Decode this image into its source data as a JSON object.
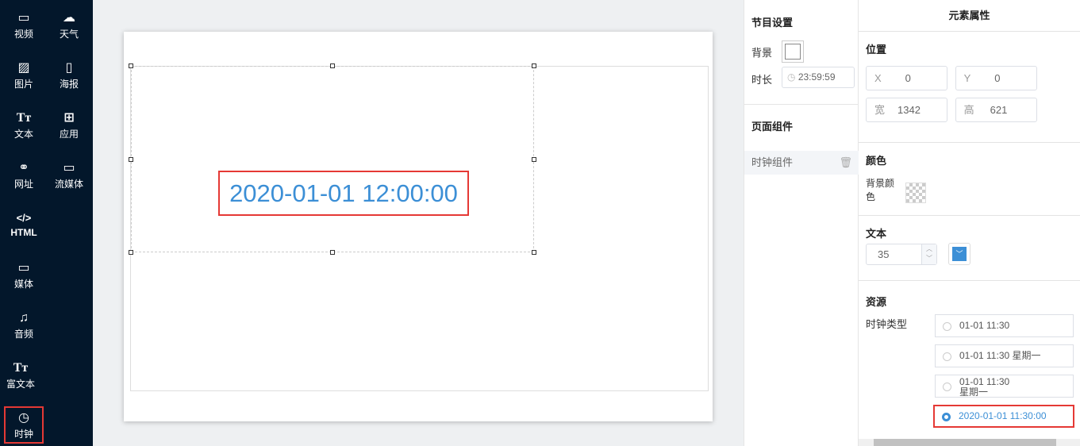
{
  "sidebar": {
    "tools": [
      {
        "label": "视频",
        "icon": "video-icon"
      },
      {
        "label": "天气",
        "icon": "cloud-icon"
      },
      {
        "label": "图片",
        "icon": "image-icon"
      },
      {
        "label": "海报",
        "icon": "poster-icon"
      },
      {
        "label": "文本",
        "icon": "text-icon"
      },
      {
        "label": "应用",
        "icon": "apps-icon"
      },
      {
        "label": "网址",
        "icon": "link-icon"
      },
      {
        "label": "流媒体",
        "icon": "stream-icon"
      },
      {
        "label": "HTML",
        "icon": "code-icon"
      },
      {
        "label": "媒体",
        "icon": "media-icon"
      },
      {
        "label": "音频",
        "icon": "music-icon"
      },
      {
        "label": "富文本",
        "icon": "richtext-icon"
      },
      {
        "label": "时钟",
        "icon": "clock-icon"
      }
    ]
  },
  "canvas": {
    "clock_text": "2020-01-01 12:00:00"
  },
  "program": {
    "title": "节目设置",
    "bg_label": "背景",
    "duration_label": "时长",
    "duration": "23:59:59",
    "components_title": "页面组件",
    "component": "时钟组件"
  },
  "props": {
    "title": "元素属性",
    "position_title": "位置",
    "x_label": "X",
    "x": "0",
    "y_label": "Y",
    "y": "0",
    "w_label": "宽",
    "w": "1342",
    "h_label": "高",
    "h": "621",
    "color_title": "颜色",
    "bg_color_label": "背景颜色",
    "text_title": "文本",
    "font_size": "35",
    "text_color": "#3c8fd6",
    "resource_title": "资源",
    "clock_type_label": "时钟类型",
    "clock_types": [
      "01-01 11:30",
      "01-01 11:30 星期一",
      "01-01 11:30\n星期一",
      "2020-01-01 11:30:00"
    ],
    "selected_index": 3
  }
}
